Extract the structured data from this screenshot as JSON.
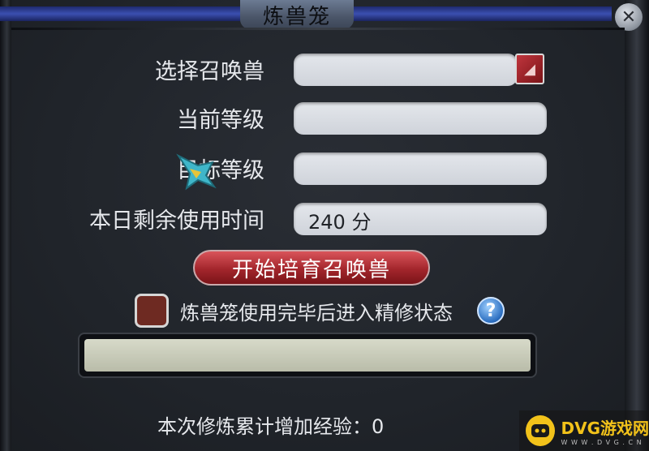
{
  "window": {
    "title": "炼兽笼",
    "close_glyph": "✕"
  },
  "fields": [
    {
      "label": "选择召唤兽",
      "value": "",
      "has_dropdown": true
    },
    {
      "label": "当前等级",
      "value": ""
    },
    {
      "label": "目标等级",
      "value": ""
    },
    {
      "label": "本日剩余使用时间",
      "value": "240 分"
    }
  ],
  "start_button": {
    "label": "开始培育召唤兽"
  },
  "option": {
    "label": "炼兽笼使用完毕后进入精修状态",
    "checked": false,
    "help_glyph": "?"
  },
  "progress": {
    "fraction": 0
  },
  "experience": {
    "text": "本次修炼累计增加经验：0"
  },
  "watermark": {
    "brand": "DVG游戏网",
    "url": "W W W . D V G . C N"
  },
  "colors": {
    "accent_red": "#a3262c",
    "title_blue": "#3b4fb0",
    "field_bg": "#dcdfe5"
  }
}
